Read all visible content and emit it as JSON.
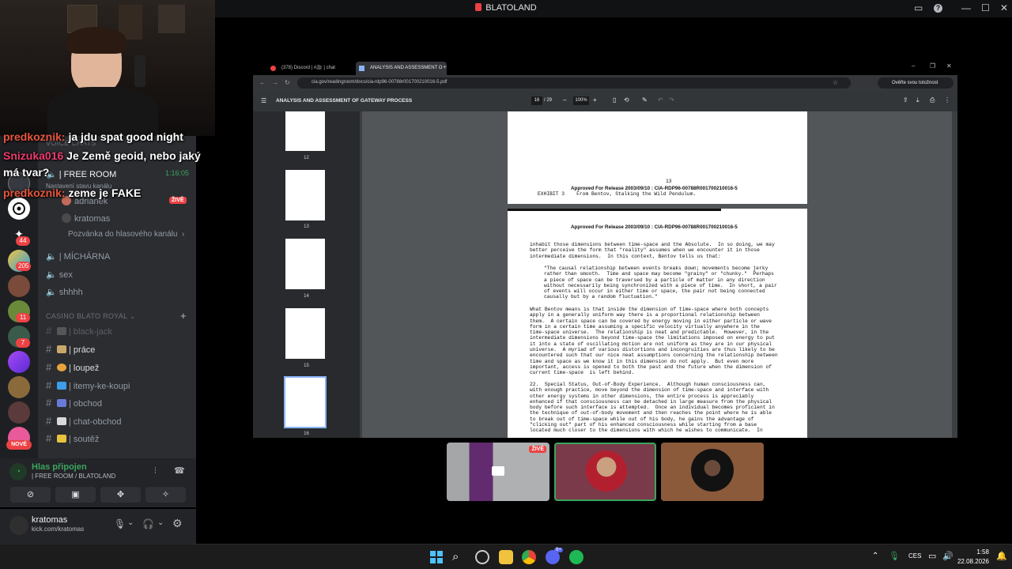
{
  "titlebar": {
    "title": "BLATOLAND"
  },
  "chat_overlay": [
    {
      "user": "predkoznik:",
      "text": "ja jdu spat good night",
      "user_color": "#e8553d"
    },
    {
      "user": "Snizuka016",
      "text": "Je Země geoid, nebo jaký",
      "user_color": "#ed3a6e"
    },
    {
      "user": "",
      "text": "má tvar?",
      "user_color": "#ffffff"
    },
    {
      "user": "predkoznik:",
      "text": "zeme je FAKE",
      "user_color": "#e8553d"
    }
  ],
  "channels": {
    "voice_category": "VOICE CHATS",
    "free_room": {
      "label": "| FREE ROOM",
      "time": "1:16:05",
      "status": "Nastavení stavu kanálu"
    },
    "members": [
      "adrianek",
      "kratomas"
    ],
    "live_badge": "ŽIVĚ",
    "invite": "Pozvánka do hlasového kanálu",
    "voice": [
      "| MÍCHÁRNA",
      "sex",
      "shhhh"
    ],
    "casino_category": "CASINO BLATO ROYAL",
    "text": [
      "| black-jack",
      "| práce",
      "| loupež",
      "| itemy-ke-koupi",
      "| obchod",
      "| chat-obchod",
      "| soutěž"
    ]
  },
  "server_badges": [
    "44",
    "205",
    "11",
    "7"
  ],
  "new_badge": "NOVÉ",
  "voice_panel": {
    "status": "Hlas připojen",
    "channel": "| FREE ROOM / BLATOLAND"
  },
  "user_panel": {
    "name": "kratomas",
    "sub": "kick.com/kratomas"
  },
  "browser": {
    "tabs": [
      "(378) Discord | #🎥 | chat",
      "ANALYSIS AND ASSESSMENT O"
    ],
    "url": "cia.gov/readingroom/docs/cia-rdp96-00788r001700210016-5.pdf",
    "verify": "Ověřte svou totožnost",
    "pdf_title": "ANALYSIS AND ASSESSMENT OF GATEWAY PROCESS",
    "page": "16",
    "pages": "/ 29",
    "zoom": "100%",
    "thumb_nums": [
      "12",
      "13",
      "14",
      "15",
      "16"
    ]
  },
  "doc": {
    "page_num": "13",
    "release": "Approved For Release 2003/09/10 : CIA-RDP96-00788R001700210016-5",
    "exhibit": "EXHIBIT 3    From Bentov, Stalking the Wild Pendulum.",
    "release2": "Approved For Release 2003/09/10 : CIA-RDP96-00788R001700210016-5",
    "para1": "inhabit those dimensions between time-space and the Absolute.  In so doing, we may\nbetter perceive the form that \"reality\" assumes when we encounter it in those\nintermediate dimensions.  In this context, Bentov tells us that:",
    "quote": "\"The causal relationship between events breaks down; movements become jerky\nrather than smooth.  Time and space may become \"grainy\" or \"chunky.\"  Perhaps\na piece of space can be traversed by a particle of matter in any direction\nwithout necessarily being synchronized with a piece of time.  In short, a pair\nof events will occur in either time or space, the pair not being connected\ncausally but by a random fluctuation.\"",
    "para2": "What Bentov means is that inside the dimension of time-space where both concepts\napply in a generally uniform way there is a proportional relationship between\nthem.  A certain space can be covered by energy moving in either particle or wave\nform in a certain time assuming a specific velocity virtually anywhere in the\ntime-space universe.  The relationship is neat and predictable.  However, in the\nintermediate dimensions beyond time-space the limitations imposed on energy to put\nit into a state of oscillating motion are not uniform as they are in our physical\nuniverse.  A myriad of various distortions and incongruities are thus likely to be\nencountered such that our nice neat assumptions concerning the relationship between\ntime and space as we know it in this dimension do not apply.  But even more\nimportant, access is opened to both the past and the future when the dimension of\ncurrent time-space  is left behind.",
    "para3": "22.  Special Status, Out-of-Body Experience.  Although human consciousness can,\nwith enough practice, move beyond the dimension of time-space and interface with\nother energy systems in other dimensions, the entire process is appreciably\nenhanced if that consciousness can be detached in large measure from the physical\nbody before such interface is attempted.  Once an individual becomes proficient in\nthe technique of out-of-body movement and then reaches the point where he is able\nto break out of time-space while out of his body, he gains the advantage of\n\"clicking out\" part of his enhanced consciousness while starting from a base\nlocated much closer to the dimensions with which he wishes to communicate.  In"
  },
  "tiles": {
    "live": "ŽIVĚ"
  },
  "taskbar": {
    "lang": "CES",
    "time": "1:58",
    "date": "22.08.2026",
    "discord_badge": "9+"
  }
}
